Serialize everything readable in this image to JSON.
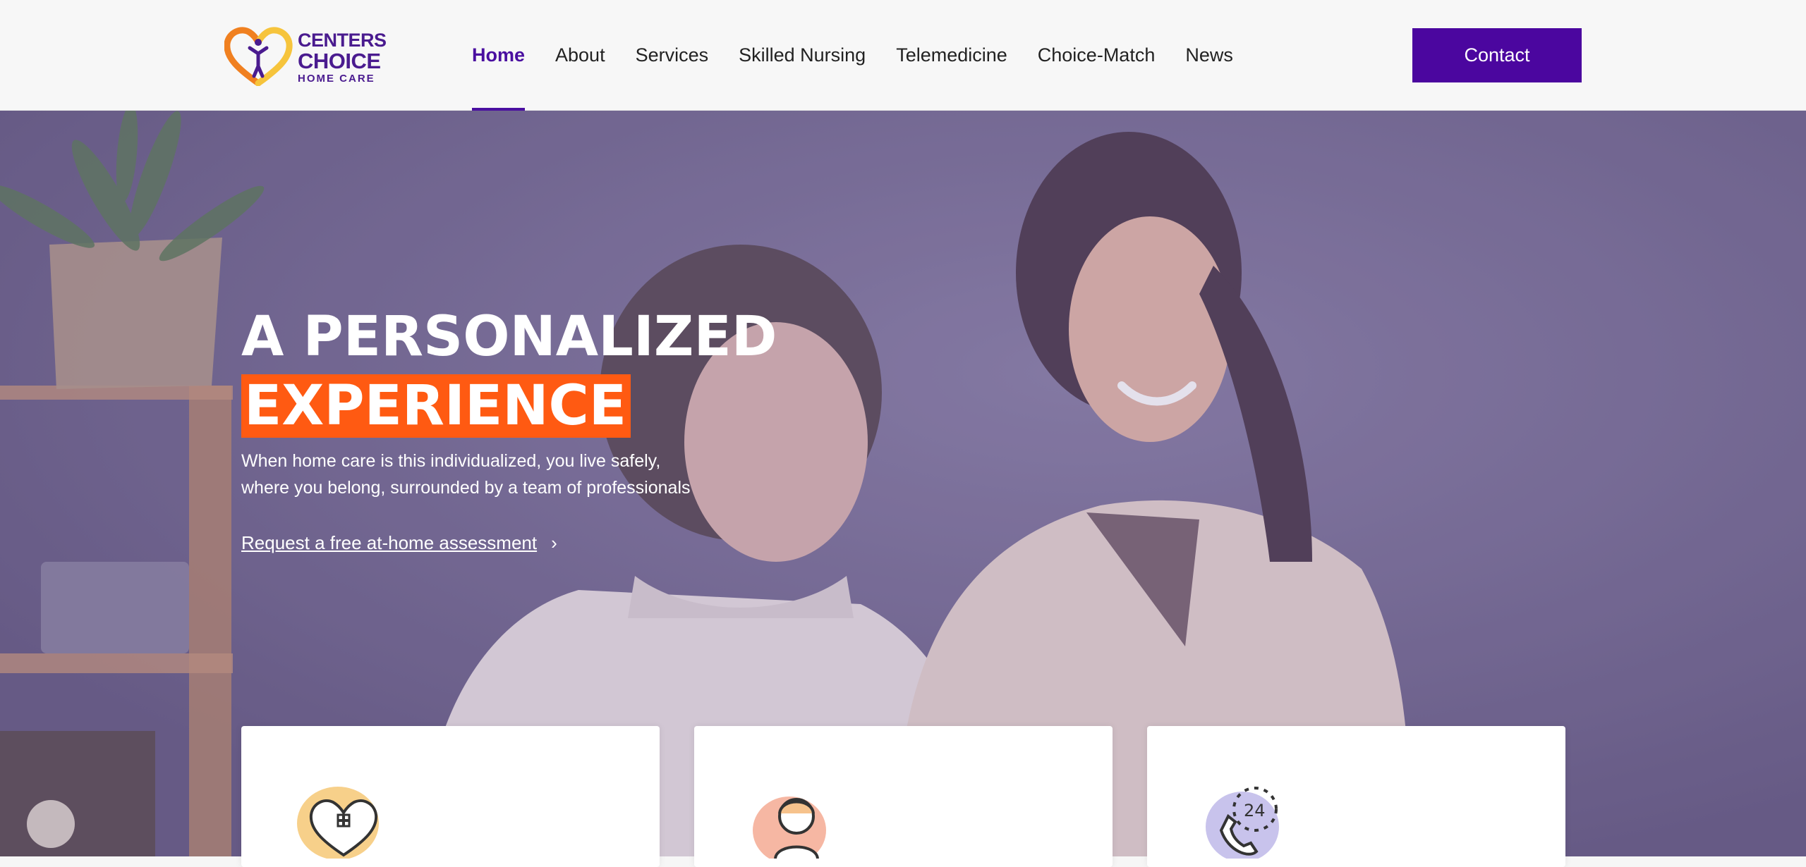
{
  "header": {
    "logo": {
      "line1": "CENTERS",
      "line2": "CHOICE",
      "line3": "HOME CARE",
      "icon": "heart-person-icon"
    },
    "nav": [
      {
        "label": "Home",
        "active": true
      },
      {
        "label": "About",
        "active": false
      },
      {
        "label": "Services",
        "active": false
      },
      {
        "label": "Skilled Nursing",
        "active": false
      },
      {
        "label": "Telemedicine",
        "active": false
      },
      {
        "label": "Choice-Match",
        "active": false
      },
      {
        "label": "News",
        "active": false
      }
    ],
    "contact_label": "Contact"
  },
  "hero": {
    "title_line1": "A PERSONALIZED",
    "title_line2": "EXPERIENCE",
    "subtitle_line1": "When home care is this individualized, you live safely,",
    "subtitle_line2": "where you belong, surrounded by a team of professionals",
    "cta_label": "Request a free at-home assessment",
    "cta_arrow": "›"
  },
  "cards": [
    {
      "icon": "heart-cross-icon"
    },
    {
      "icon": "nurse-icon"
    },
    {
      "icon": "phone-24-icon",
      "icon_text": "24"
    }
  ],
  "colors": {
    "brand_purple": "#4b069f",
    "accent_orange": "#ff5a12",
    "logo_orange": "#f28b1e",
    "logo_yellow": "#f6c43c"
  }
}
